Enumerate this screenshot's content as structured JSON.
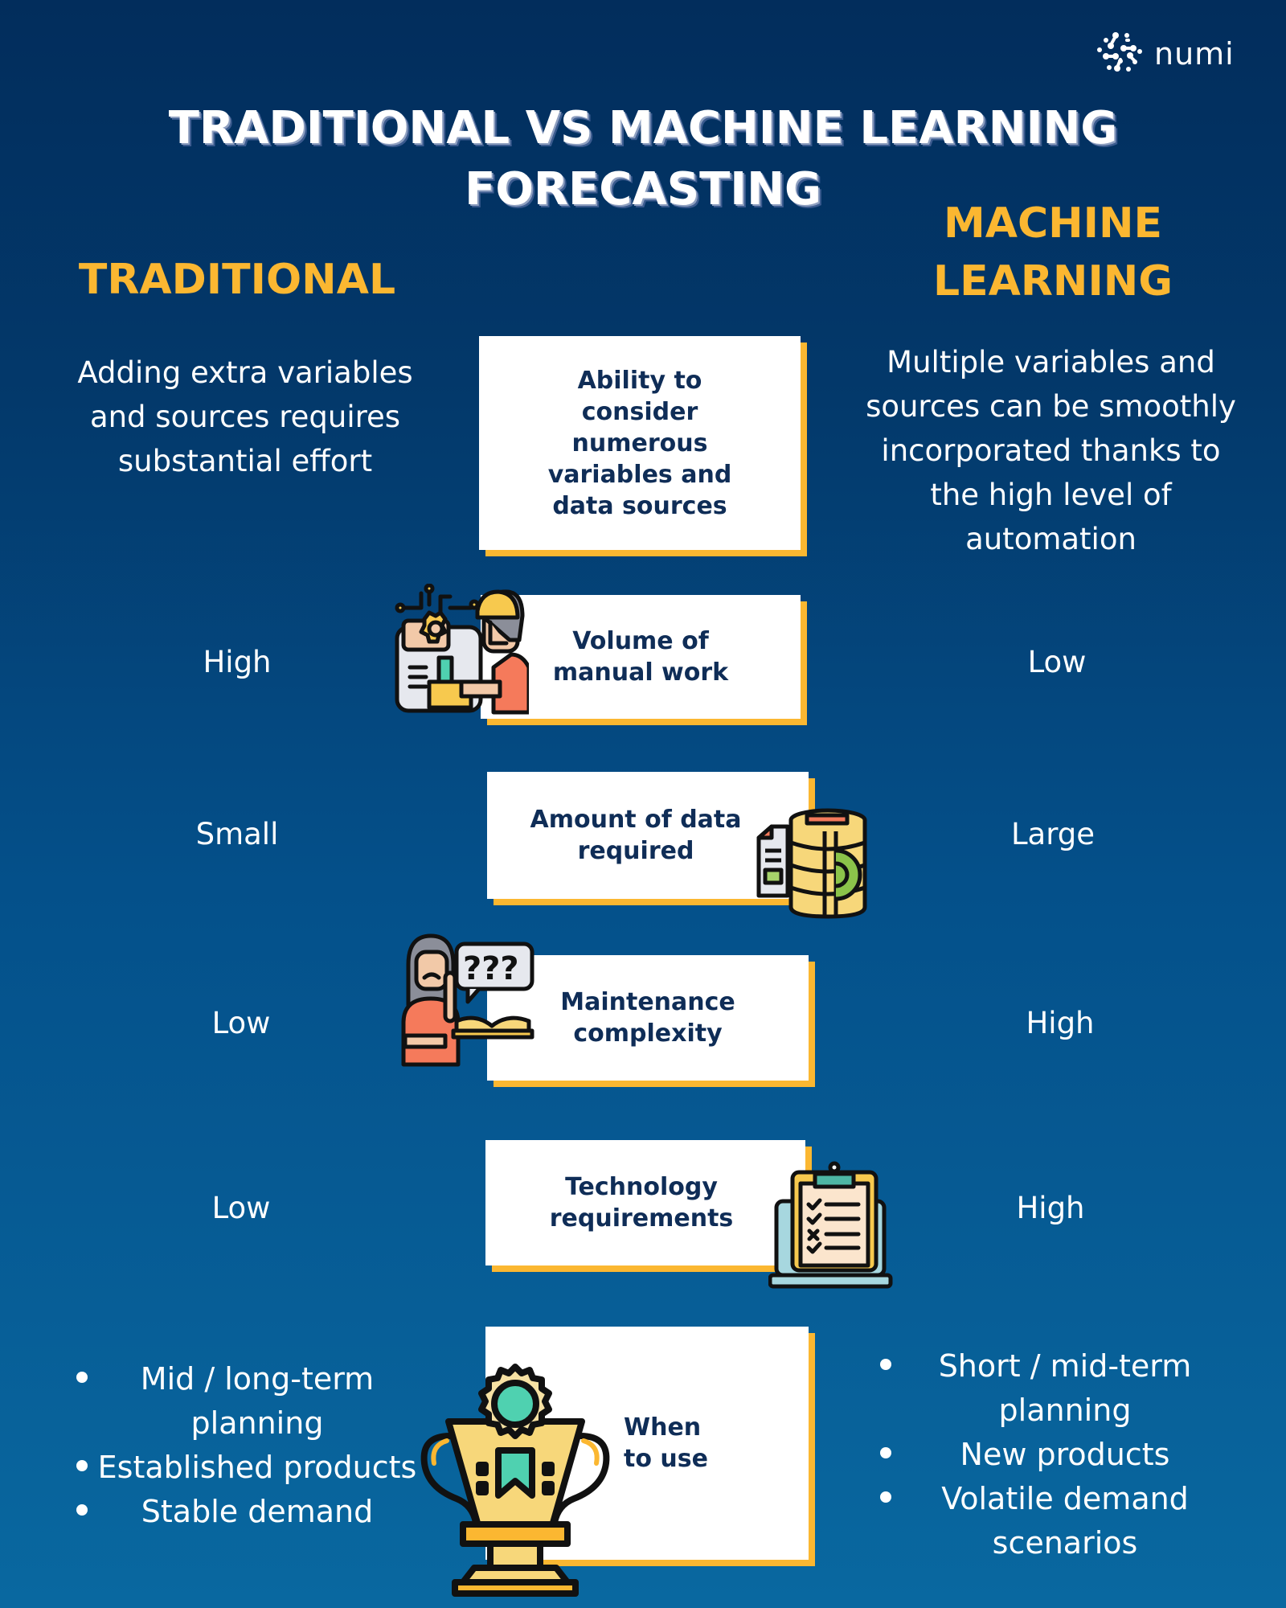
{
  "brand": {
    "logo_icon": "molecule-network-icon",
    "name": "numi"
  },
  "title": {
    "line1": "TRADITIONAL VS MACHINE LEARNING",
    "line2": "FORECASTING"
  },
  "columns": {
    "left_heading": "TRADITIONAL",
    "right_heading_line1": "MACHINE",
    "right_heading_line2": "LEARNING"
  },
  "colors": {
    "background_top": "#022d5c",
    "background_bottom": "#0968a0",
    "accent_yellow": "#fbb731",
    "box_text": "#0f2d57",
    "box_fill": "#ffffff"
  },
  "rows": [
    {
      "criterion_lines": [
        "Ability to",
        "consider",
        "numerous",
        "variables and",
        "data sources"
      ],
      "traditional_lines": [
        "Adding extra variables",
        "and sources requires",
        "substantial effort"
      ],
      "ml_lines": [
        "Multiple variables and",
        "sources can be smoothly",
        "incorporated thanks to",
        "the high level of",
        "automation"
      ],
      "icon": null
    },
    {
      "criterion_lines": [
        "Volume of",
        "manual work"
      ],
      "traditional": "High",
      "ml": "Low",
      "icon": "worker-with-gear-dashboard-icon"
    },
    {
      "criterion_lines": [
        "Amount of data",
        "required"
      ],
      "traditional": "Small",
      "ml": "Large",
      "icon": "database-gear-icon"
    },
    {
      "criterion_lines": [
        "Maintenance",
        "complexity"
      ],
      "traditional": "Low",
      "ml": "High",
      "icon": "confused-person-question-book-icon"
    },
    {
      "criterion_lines": [
        "Technology",
        "requirements"
      ],
      "traditional": "Low",
      "ml": "High",
      "icon": "laptop-checklist-icon"
    },
    {
      "criterion_lines": [
        "When",
        "to use"
      ],
      "traditional_bullets": [
        [
          "Mid / long-term",
          "planning"
        ],
        [
          "Established products"
        ],
        [
          "Stable demand"
        ]
      ],
      "ml_bullets": [
        [
          "Short / mid-term",
          "planning"
        ],
        [
          "New products"
        ],
        [
          "Volatile demand",
          "scenarios"
        ]
      ],
      "icon": "trophy-award-icon"
    }
  ]
}
